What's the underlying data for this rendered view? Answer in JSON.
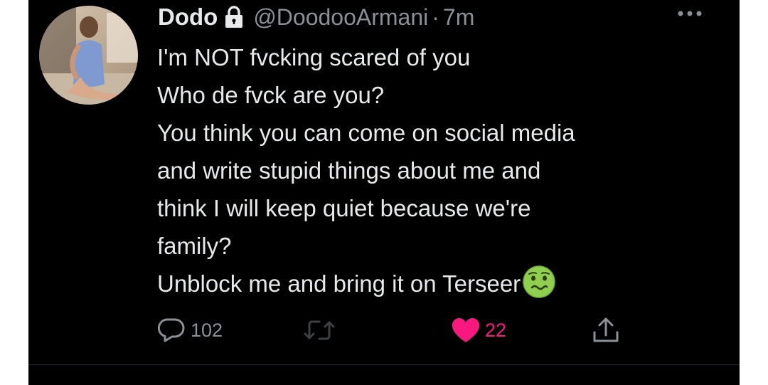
{
  "tweet": {
    "display_name": "Dodo",
    "handle": "@DoodooArmani",
    "separator": "·",
    "time": "7m",
    "text_lines": [
      "I'm NOT fvcking scared of you",
      "Who de fvck are you?",
      "You think you can come on social media",
      "and write stupid things about me and",
      "think I will keep quiet because we're",
      "family?",
      "Unblock me and bring it on Terseer"
    ],
    "emoji": "nauseated-face-emoji",
    "protected_account_icon": "lock-icon",
    "actions": {
      "reply_count": "102",
      "retweet_count": "",
      "like_count": "22",
      "liked": true
    },
    "colors": {
      "background": "#000000",
      "text": "#e7e9ea",
      "secondary_text": "#8b9096",
      "like": "#f91880",
      "emoji": "#8fce4f"
    }
  }
}
